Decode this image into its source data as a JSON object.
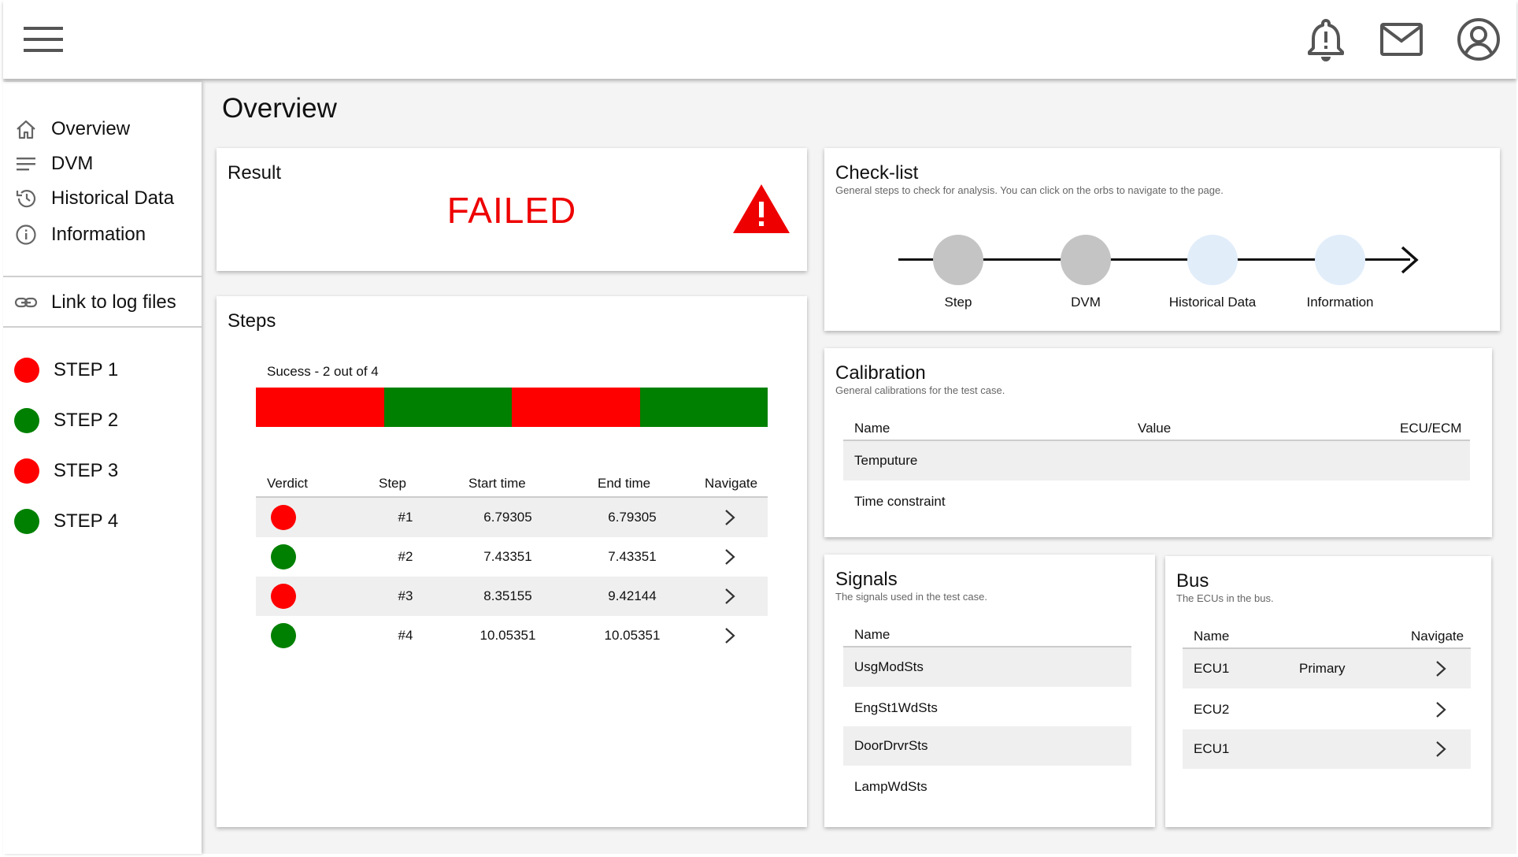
{
  "header": {
    "menu_icon": "hamburger-menu-icon",
    "icons": [
      "bell-alert-icon",
      "mail-icon",
      "account-icon"
    ]
  },
  "sidebar": {
    "nav": [
      {
        "label": "Overview",
        "icon": "home-icon"
      },
      {
        "label": "DVM",
        "icon": "lines-icon"
      },
      {
        "label": "Historical Data",
        "icon": "history-icon"
      },
      {
        "label": "Information",
        "icon": "info-icon"
      }
    ],
    "link": {
      "label": "Link to log files",
      "icon": "link-icon"
    },
    "steps": [
      {
        "label": "STEP 1",
        "status": "failed"
      },
      {
        "label": "STEP 2",
        "status": "passed"
      },
      {
        "label": "STEP 3",
        "status": "failed"
      },
      {
        "label": "STEP 4",
        "status": "passed"
      }
    ]
  },
  "colors": {
    "failed": "#ff0000",
    "passed": "#008000",
    "failed_text": "#ee0000",
    "orb_done": "#c4c4c4",
    "orb_pending": "#e2edfa"
  },
  "page": {
    "title": "Overview"
  },
  "result": {
    "title": "Result",
    "status": "FAILED",
    "icon": "warning-icon"
  },
  "steps_card": {
    "title": "Steps",
    "progress_label": "Sucess - 2 out of  4",
    "progress": [
      "failed",
      "passed",
      "failed",
      "passed"
    ],
    "columns": [
      "Verdict",
      "Step",
      "Start time",
      "End time",
      "Navigate"
    ],
    "rows": [
      {
        "verdict": "failed",
        "step": "#1",
        "start": "6.79305",
        "end": "6.79305"
      },
      {
        "verdict": "passed",
        "step": "#2",
        "start": "7.43351",
        "end": "7.43351"
      },
      {
        "verdict": "failed",
        "step": "#3",
        "start": "8.35155",
        "end": "9.42144"
      },
      {
        "verdict": "passed",
        "step": "#4",
        "start": "10.05351",
        "end": "10.05351"
      }
    ]
  },
  "checklist": {
    "title": "Check-list",
    "subtitle": "General steps to check for analysis. You can click on the orbs to navigate to the page.",
    "orbs": [
      {
        "label": "Step",
        "state": "done"
      },
      {
        "label": "DVM",
        "state": "done"
      },
      {
        "label": "Historical Data",
        "state": "pending"
      },
      {
        "label": "Information",
        "state": "pending"
      }
    ]
  },
  "calibration": {
    "title": "Calibration",
    "subtitle": "General calibrations for the test case.",
    "columns": [
      "Name",
      "Value",
      "ECU/ECM"
    ],
    "rows": [
      "Temputure",
      "Time constraint"
    ]
  },
  "signals": {
    "title": "Signals",
    "subtitle": "The signals used in the test case.",
    "column": "Name",
    "rows": [
      "UsgModSts",
      "EngSt1WdSts",
      "DoorDrvrSts",
      "LampWdSts"
    ]
  },
  "bus": {
    "title": "Bus",
    "subtitle": "The ECUs in the bus.",
    "columns": [
      "Name",
      "Navigate"
    ],
    "rows": [
      {
        "name": "ECU1",
        "role": "Primary"
      },
      {
        "name": "ECU2",
        "role": ""
      },
      {
        "name": "ECU1",
        "role": ""
      }
    ]
  }
}
